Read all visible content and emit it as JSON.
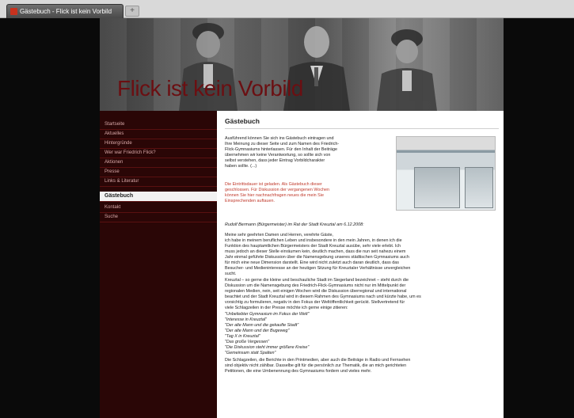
{
  "browser": {
    "tab_title": "Gästebuch - Flick ist kein Vorbild",
    "new_tab_symbol": "+"
  },
  "banner": {
    "title": "Flick ist kein Vorbild"
  },
  "sidebar": {
    "items": [
      {
        "label": "Startseite",
        "active": false
      },
      {
        "label": "Aktuelles",
        "active": false
      },
      {
        "label": "Hintergründe",
        "active": false
      },
      {
        "label": "Wer war Friedrich Flick?",
        "active": false
      },
      {
        "label": "Aktionen",
        "active": false
      },
      {
        "label": "Presse",
        "active": false
      },
      {
        "label": "Links & Literatur",
        "active": false
      },
      {
        "label": "Gästebuch",
        "active": true
      },
      {
        "label": "Kontakt",
        "active": false
      },
      {
        "label": "Suche",
        "active": false
      }
    ]
  },
  "content": {
    "heading": "Gästebuch",
    "intro_lines": [
      "Ausführend können Sie sich ins Gästebuch eintragen und",
      "Ihre Meinung zu dieser Seite und zum Namen des Friedrich-",
      "Flick-Gymnasiums hinterlassen. Für den Inhalt der Beiträge",
      "übernehmen wir keine Verantwortung, so sollte sich von",
      "selbst verstehen, dass jeder Eintrag Vorbildcharakter",
      "haben sollte. (...)"
    ],
    "notice_lines": [
      "Die Eintrittsdauer ist geladen. Als Gästebuch dieser",
      "geschlossen. Für Diskussion der vergangenen Wochen",
      "können Sie hier nachnachfragen neues die mein Sie",
      "Einsprechenden auftauen."
    ],
    "author_line": "Rudolf Bermann (Bürgermeister) im Rat der Stadt Kreuztal am 6.12.2008:",
    "body_lines": [
      "Meine sehr geehrten Damen und Herren, verehrte Gäste,",
      "ich habe in meinem beruflichen Leben und insbesondere in den mein Jahren, in denen ich die",
      "Funktion des hauptamtlichen Bürgermeisters der Stadt Kreuztal ausübe, sehr viele erlebt. Ich",
      "muss jedoch an dieser Stelle einräumen kein, deutlich machen, dass die nun seit nahezu einem",
      "Jahr einmal geführte Diskussion über die Namensgebung unseres städtischen Gymnasiums auch",
      "für mich eine neue Dimension darstellt. Eine wird nicht zuletzt auch daran deutlich, dass das",
      "Besucher- und Medieninteresse an der heutigen Sitzung für Kreuztaler Verhältnisse unvergleichen",
      "sucht.",
      "Kreuztal – so gerne die kleine und beschauliche Stadt im Siegerland bezeichnet – steht durch die",
      "Diskussion um die Namensgebung des Friedrich-Flick-Gymnasiums nicht nur im Mittelpunkt der",
      "regionalen Medien, nein, seit einigen Wochen wird die Diskussion überregional und international",
      "beachtet und der Stadt Kreuztal wird in diesem Rahmen des Gymnasiums nach und kürzte habe, um es",
      "vorsichtig zu formulieren, negativ in den Fokus der Weltöffentlichkeit gerückt. Stellvertretend für",
      "viele Schlagzeilen in der Presse möchte ich gerne einige zitieren:"
    ],
    "quote_lines": [
      "\"Unbeliebter Gymnasium im Fokus der Welt\"",
      "\"Interesse in Kreuztal\"",
      "\"Der alte Mann und die gekaufte Stadt\"",
      "\"Der alte Mann und der Bugeweg\"",
      "\"Tag X in Kreuztal\"",
      "\"Das große Vergessen\"",
      "\"Die Diskussion steht immer größere Kreise\"",
      "\"Gemeinsam statt Spalten\""
    ],
    "closing_lines": [
      "Die Schlagzeilen, die Berichte in den Printmedien, aber auch die Beiträge in Radio und Fernsehen",
      "sind objektiv nicht zählbar. Dasselbe gilt für die persönlich zur Thematik, die an mich gerichteten",
      "Petitionen, die eine Umbenennung des Gymnasiums fordern und vieles mehr."
    ]
  }
}
